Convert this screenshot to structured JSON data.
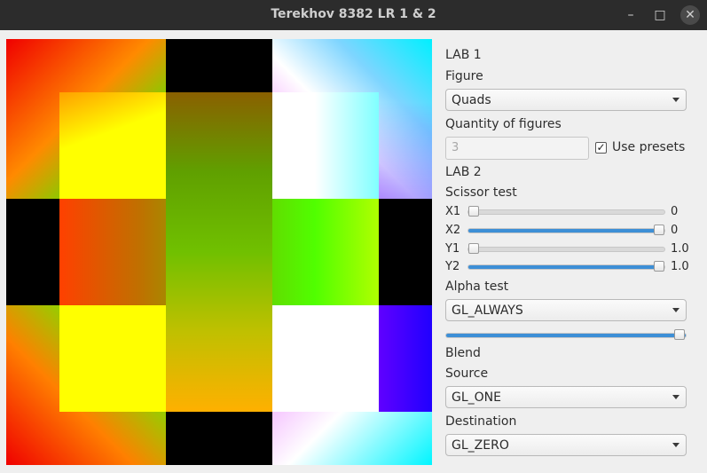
{
  "window": {
    "title": "Terekhov 8382 LR 1 & 2"
  },
  "controls": {
    "minimize_icon": "minimize-icon",
    "maximize_icon": "maximize-icon",
    "close_icon": "close-icon"
  },
  "panel": {
    "lab1_heading": "LAB 1",
    "figure_label": "Figure",
    "figure_value": "Quads",
    "quantity_label": "Quantity of figures",
    "quantity_value": "3",
    "use_presets_label": "Use presets",
    "use_presets_checked": true,
    "lab2_heading": "LAB 2",
    "scissor_label": "Scissor test",
    "sliders": [
      {
        "label": "X1",
        "value_text": "0",
        "value": 0.0
      },
      {
        "label": "X2",
        "value_text": "0",
        "value": 1.0
      },
      {
        "label": "Y1",
        "value_text": "1.0",
        "value": 0.0
      },
      {
        "label": "Y2",
        "value_text": "1.0",
        "value": 1.0
      }
    ],
    "alpha_label": "Alpha test",
    "alpha_value": "GL_ALWAYS",
    "alpha_slider_value": 1.0,
    "blend_label": "Blend",
    "source_label": "Source",
    "source_value": "GL_ONE",
    "destination_label": "Destination",
    "destination_value": "GL_ZERO"
  },
  "colors": {
    "accent": "#3d8fd6",
    "titlebar": "#2c2c2c",
    "panel_bg": "#efefef"
  }
}
